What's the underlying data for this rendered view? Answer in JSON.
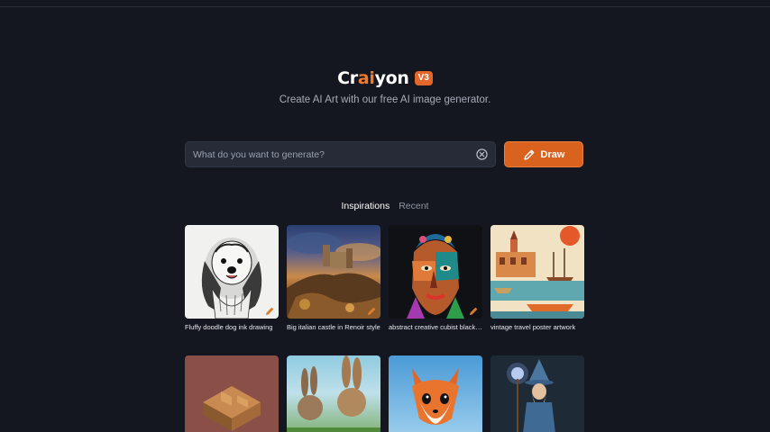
{
  "brand": {
    "name_pre": "Cr",
    "name_accent": "ai",
    "name_post": "yon",
    "badge": "V3"
  },
  "tagline": "Create AI Art with our free AI image generator.",
  "search": {
    "placeholder": "What do you want to generate?",
    "value": ""
  },
  "draw_button": {
    "label": "Draw"
  },
  "tabs": [
    {
      "label": "Inspirations",
      "active": true
    },
    {
      "label": "Recent",
      "active": false
    }
  ],
  "gallery": [
    {
      "caption": "Fluffy doodle dog ink drawing"
    },
    {
      "caption": "Big italian castle in Renoir style"
    },
    {
      "caption": "abstract creative cubist black man"
    },
    {
      "caption": "vintage travel poster artwork"
    },
    {
      "caption": ""
    },
    {
      "caption": ""
    },
    {
      "caption": ""
    },
    {
      "caption": ""
    }
  ],
  "colors": {
    "background": "#14171f",
    "accent": "#d9621f",
    "input_bg": "#262b37"
  }
}
